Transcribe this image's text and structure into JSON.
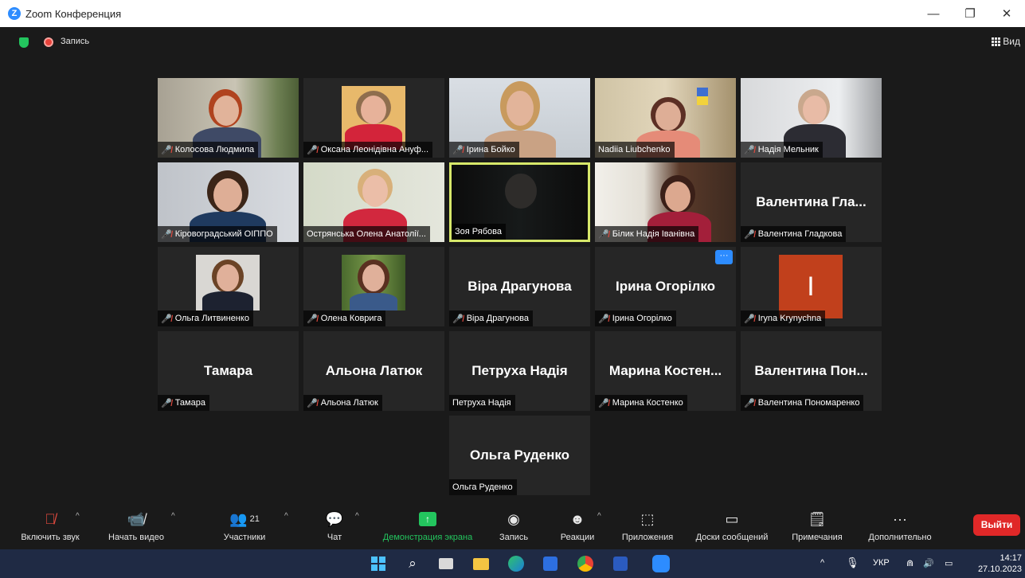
{
  "window": {
    "title": "Zoom Конференция",
    "logo_letter": "Z"
  },
  "meeting": {
    "recording_label": "Запись",
    "view_label": "Вид"
  },
  "tiles": {
    "t1": "Колосова Людмила",
    "t2": "Оксана Леонідівна Ануф...",
    "t3": "Ірина Бойко",
    "t4": "Nadiia Liubchenko",
    "t5": "Надія Мельник",
    "t6": "Кіровоградський ОІППО",
    "t7": "Острянська Олена Анатолії...",
    "t8": "Зоя Рябова",
    "t9": "Білик Надія Іванівна",
    "t10_big": "Валентина Гла...",
    "t10": "Валентина Гладкова",
    "t11": "Ольга Литвиненко",
    "t12": "Олена Коврига",
    "t13_big": "Віра Драгунова",
    "t13": "Віра Драгунова",
    "t14_big": "Ірина Огорілко",
    "t14": "Ірина Огорілко",
    "t15_avatar": "I",
    "t15": "Iryna Krynychna",
    "t16_big": "Тамара",
    "t16": "Тамара",
    "t17_big": "Альона Латюк",
    "t17": "Альона Латюк",
    "t18_big": "Петруха Надія",
    "t18": "Петруха Надія",
    "t19_big": "Марина Костен...",
    "t19": "Марина Костенко",
    "t20_big": "Валентина Пон...",
    "t20": "Валентина Пономаренко",
    "t21_big": "Ольга Руденко",
    "t21": "Ольга Руденко"
  },
  "toolbar": {
    "audio": "Включить звук",
    "video": "Начать видео",
    "participants": "Участники",
    "participants_count": "21",
    "chat": "Чат",
    "share": "Демонстрация экрана",
    "record": "Запись",
    "reactions": "Реакции",
    "apps": "Приложения",
    "whiteboards": "Доски сообщений",
    "notes": "Примечания",
    "more": "Дополнительно",
    "leave": "Выйти"
  },
  "taskbar": {
    "language": "УКР",
    "time": "14:17",
    "date": "27.10.2023"
  },
  "colors": {
    "accent": "#2d8cff",
    "share_green": "#23c55e",
    "leave_red": "#e02828",
    "active_speaker": "#d7e86a"
  }
}
